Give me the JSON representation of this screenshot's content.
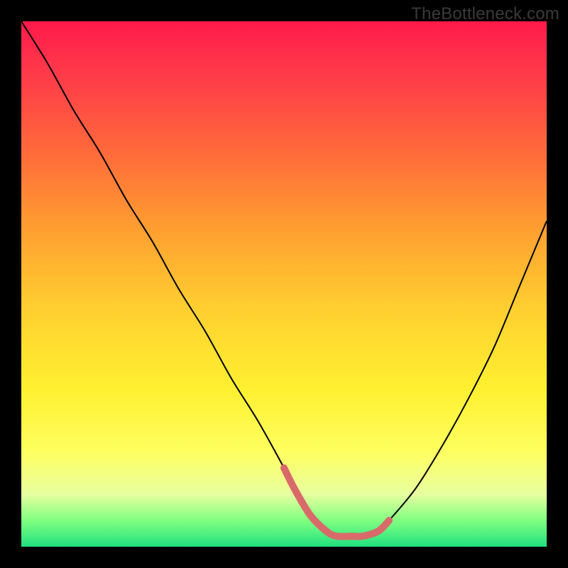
{
  "watermark": "TheBottleneck.com",
  "chart_data": {
    "type": "line",
    "title": "",
    "xlabel": "",
    "ylabel": "",
    "xlim": [
      0,
      100
    ],
    "ylim": [
      0,
      100
    ],
    "grid": false,
    "legend": false,
    "annotations": [],
    "series": [
      {
        "name": "bottleneck-curve",
        "color": "#000000",
        "x": [
          0,
          5,
          10,
          15,
          20,
          25,
          30,
          35,
          40,
          45,
          50,
          52,
          55,
          58,
          60,
          63,
          65,
          68,
          70,
          75,
          80,
          85,
          90,
          95,
          100
        ],
        "y": [
          100,
          92,
          83,
          75,
          66,
          58,
          49,
          41,
          32,
          24,
          15,
          11,
          6,
          3,
          2,
          2,
          2,
          3,
          5,
          11,
          19,
          28,
          38,
          50,
          62
        ]
      },
      {
        "name": "highlight-region",
        "color": "#d96a6a",
        "x": [
          50,
          52,
          55,
          58,
          60,
          63,
          65,
          68,
          70
        ],
        "y": [
          15,
          11,
          6,
          3,
          2,
          2,
          2,
          3,
          5
        ]
      }
    ]
  }
}
